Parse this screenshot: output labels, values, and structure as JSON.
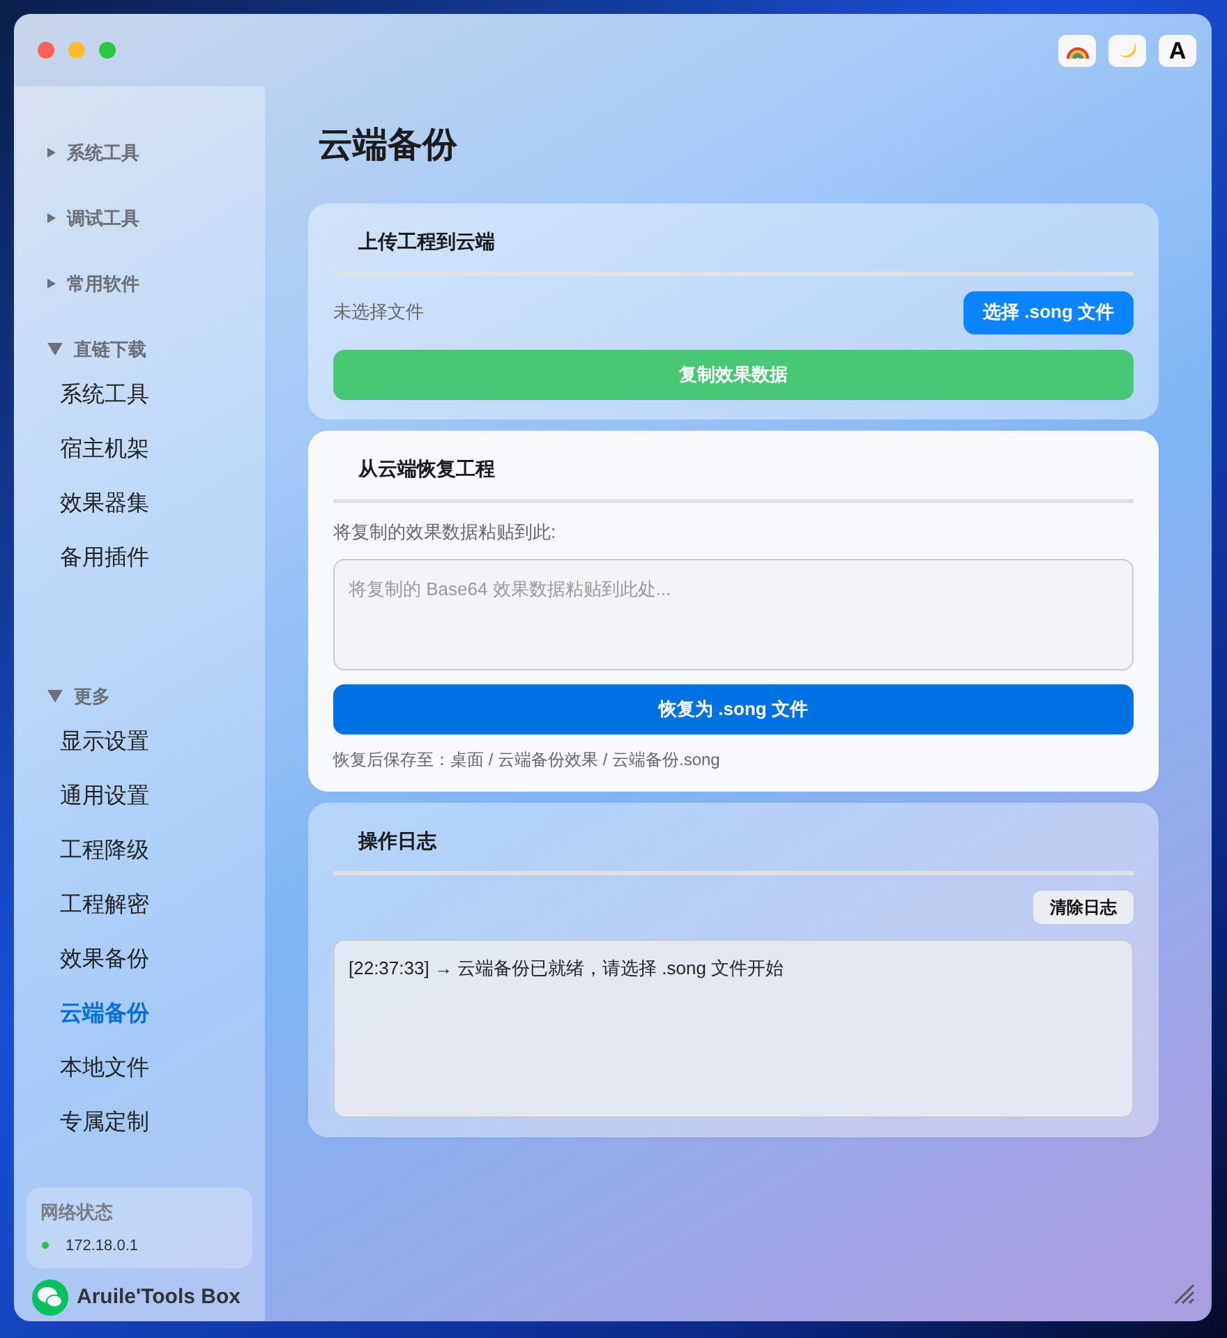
{
  "toolbar": {
    "font_button": "A"
  },
  "sidebar": {
    "groups": [
      {
        "label": "系统工具",
        "expanded": false
      },
      {
        "label": "调试工具",
        "expanded": false
      },
      {
        "label": "常用软件",
        "expanded": false
      },
      {
        "label": "直链下载",
        "expanded": true,
        "children": [
          {
            "label": "系统工具",
            "selected": false
          },
          {
            "label": "宿主机架",
            "selected": false
          },
          {
            "label": "效果器集",
            "selected": false
          },
          {
            "label": "备用插件",
            "selected": false
          }
        ]
      },
      {
        "label": "更多",
        "expanded": true,
        "children": [
          {
            "label": "显示设置",
            "selected": false
          },
          {
            "label": "通用设置",
            "selected": false
          },
          {
            "label": "工程降级",
            "selected": false
          },
          {
            "label": "工程解密",
            "selected": false
          },
          {
            "label": "效果备份",
            "selected": false
          },
          {
            "label": "云端备份",
            "selected": true
          },
          {
            "label": "本地文件",
            "selected": false
          },
          {
            "label": "专属定制",
            "selected": false
          }
        ]
      }
    ],
    "network": {
      "title": "网络状态",
      "address": "172.18.0.1",
      "online": true
    },
    "brand": "Aruile'Tools Box"
  },
  "page_title": "云端备份",
  "upload_card": {
    "title": "上传工程到云端",
    "emphasized": false,
    "file_status": "未选择文件",
    "choose_button": "选择 .song 文件",
    "copy_button": "复制效果数据"
  },
  "restore_card": {
    "title": "从云端恢复工程",
    "emphasized": true,
    "paste_label": "将复制的效果数据粘贴到此:",
    "paste_placeholder": "将复制的 Base64 效果数据粘贴到此处...",
    "restore_button": "恢复为 .song 文件",
    "save_note": "恢复后保存至：桌面 / 云端备份效果 / 云端备份.song"
  },
  "log_card": {
    "title": "操作日志",
    "emphasized": false,
    "clear_button": "清除日志",
    "entries": [
      "[22:37:33] → 云端备份已就绪，请选择 .song 文件开始"
    ]
  }
}
